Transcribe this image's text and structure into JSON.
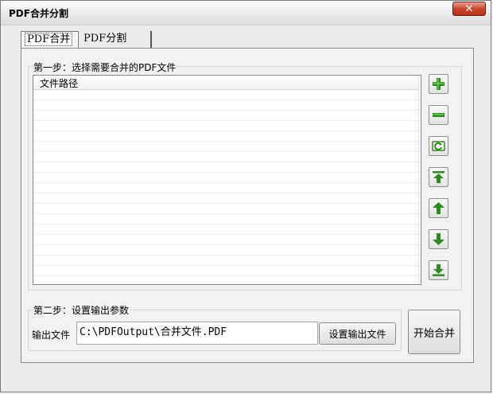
{
  "window": {
    "title": "PDF合并分割",
    "close_glyph": "✕"
  },
  "tabs": [
    {
      "label": "PDF合并",
      "active": true
    },
    {
      "label": "PDF分割",
      "active": false
    }
  ],
  "step1": {
    "label": "第一步：选择需要合并的PDF文件",
    "list": {
      "column_header": "文件路径",
      "rows": []
    }
  },
  "side_buttons": [
    {
      "icon": "add-icon"
    },
    {
      "icon": "remove-icon"
    },
    {
      "icon": "refresh-icon"
    },
    {
      "icon": "move-to-top-icon"
    },
    {
      "icon": "move-up-icon"
    },
    {
      "icon": "move-down-icon"
    },
    {
      "icon": "move-to-bottom-icon"
    }
  ],
  "step2": {
    "label": "第二步：设置输出参数",
    "output_label": "输出文件",
    "output_path": "C:\\PDFOutput\\合并文件.PDF",
    "set_output_button": "设置输出文件"
  },
  "start_button": "开始合并",
  "colors": {
    "icon_green": "#2e8b1f",
    "close_red": "#c7462e"
  }
}
